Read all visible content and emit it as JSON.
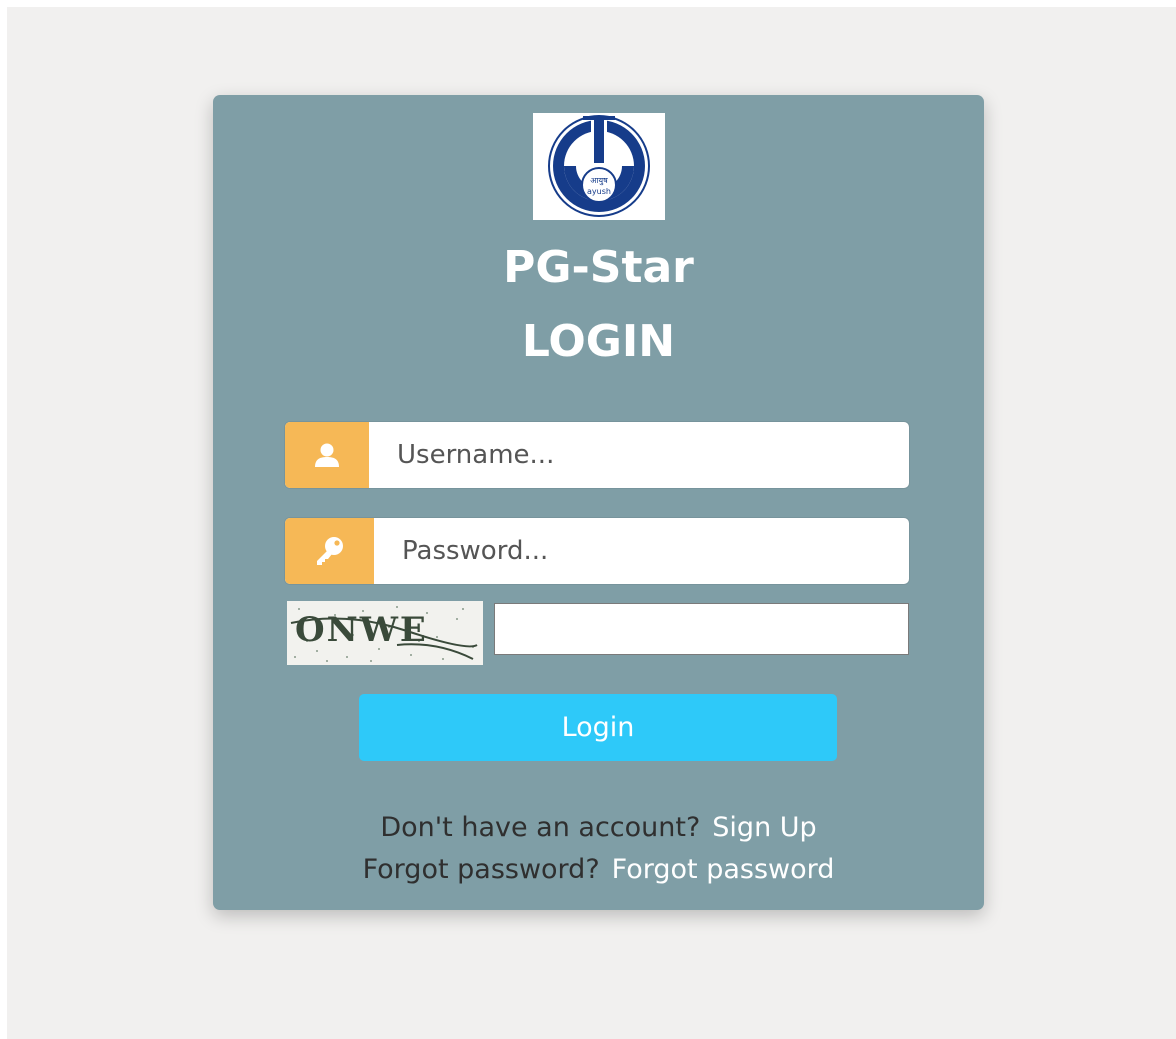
{
  "logo": {
    "icon": "ayush-emblem",
    "text_top": "आयुष",
    "text_bottom": "ayush",
    "colors": {
      "blue": "#163c8a",
      "white": "#ffffff"
    }
  },
  "header": {
    "title": "PG-Star",
    "subtitle": "LOGIN"
  },
  "form": {
    "username": {
      "icon": "user-icon",
      "placeholder": "Username...",
      "value": ""
    },
    "password": {
      "icon": "key-icon",
      "placeholder": "Password...",
      "value": ""
    },
    "captcha": {
      "text": "ONWE",
      "value": ""
    },
    "login_label": "Login"
  },
  "footer": {
    "signup_prompt": "Don't have an account?",
    "signup_link": "Sign Up",
    "forgot_prompt": "Forgot password?",
    "forgot_link": "Forgot password"
  },
  "colors": {
    "page_background": "#f1f0ef",
    "card_background": "#7f9ea6",
    "addon": "#f6b856",
    "button": "#2ec9f9",
    "link": "#ffffff"
  }
}
